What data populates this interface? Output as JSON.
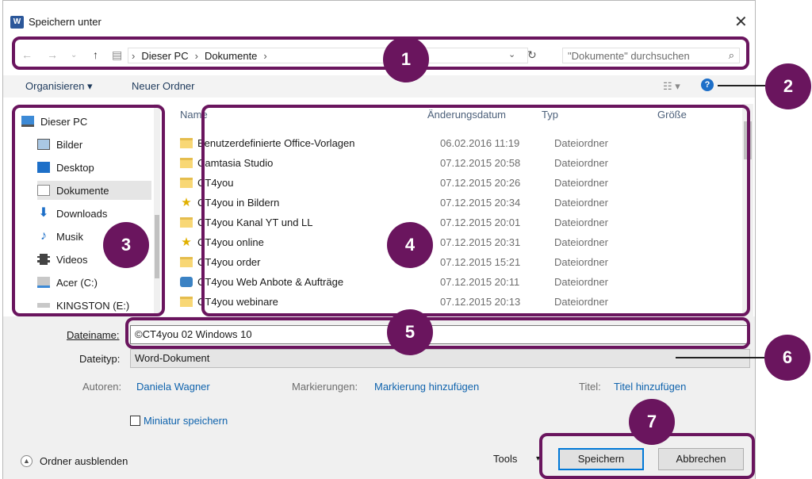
{
  "window": {
    "title": "Speichern unter",
    "close_icon": "close-icon",
    "app_icon": "word-icon"
  },
  "address": {
    "crumbs": [
      "Dieser PC",
      "Dokumente"
    ],
    "separator": "›",
    "search_placeholder": "\"Dokumente\" durchsuchen"
  },
  "toolbar": {
    "organize": "Organisieren ▾",
    "new_folder": "Neuer Ordner",
    "view_icon": "view-options-icon",
    "help_icon": "help-icon"
  },
  "sidebar": {
    "items": [
      {
        "label": "Dieser PC",
        "icon": "computer-icon"
      },
      {
        "label": "Bilder",
        "icon": "pictures-icon"
      },
      {
        "label": "Desktop",
        "icon": "desktop-icon"
      },
      {
        "label": "Dokumente",
        "icon": "documents-icon"
      },
      {
        "label": "Downloads",
        "icon": "downloads-icon"
      },
      {
        "label": "Musik",
        "icon": "music-icon"
      },
      {
        "label": "Videos",
        "icon": "videos-icon"
      },
      {
        "label": "Acer (C:)",
        "icon": "drive-icon"
      },
      {
        "label": "KINGSTON (E:)",
        "icon": "usb-drive-icon"
      }
    ],
    "selected": "Dokumente"
  },
  "filelist": {
    "columns": [
      "Name",
      "Änderungsdatum",
      "Typ",
      "Größe"
    ],
    "rows": [
      {
        "name": "Benutzerdefinierte Office-Vorlagen",
        "date": "06.02.2016 11:19",
        "type": "Dateiordner",
        "icon": "folder-icon"
      },
      {
        "name": "Camtasia Studio",
        "date": "07.12.2015 20:58",
        "type": "Dateiordner",
        "icon": "folder-icon"
      },
      {
        "name": "CT4you",
        "date": "07.12.2015 20:26",
        "type": "Dateiordner",
        "icon": "folder-icon"
      },
      {
        "name": "CT4you in Bildern",
        "date": "07.12.2015 20:34",
        "type": "Dateiordner",
        "icon": "favorite-folder-icon"
      },
      {
        "name": "CT4you Kanal YT und LL",
        "date": "07.12.2015 20:01",
        "type": "Dateiordner",
        "icon": "folder-icon"
      },
      {
        "name": "CT4you online",
        "date": "07.12.2015 20:31",
        "type": "Dateiordner",
        "icon": "favorite-folder-icon"
      },
      {
        "name": "CT4you order",
        "date": "07.12.2015 15:21",
        "type": "Dateiordner",
        "icon": "folder-icon"
      },
      {
        "name": "CT4you Web Anbote & Aufträge",
        "date": "07.12.2015 20:11",
        "type": "Dateiordner",
        "icon": "shortcut-folder-icon"
      },
      {
        "name": "CT4you webinare",
        "date": "07.12.2015 20:13",
        "type": "Dateiordner",
        "icon": "folder-icon"
      }
    ]
  },
  "form": {
    "filename_label": "Dateiname:",
    "filename_value": "©CT4you 02 Windows 10",
    "filetype_label": "Dateityp:",
    "filetype_value": "Word-Dokument",
    "authors_label": "Autoren:",
    "authors_value": "Daniela Wagner",
    "tags_label": "Markierungen:",
    "tags_value": "Markierung hinzufügen",
    "title_label": "Titel:",
    "title_value": "Titel hinzufügen",
    "thumbnail_label": "Miniatur speichern"
  },
  "footer": {
    "hide_folders": "Ordner ausblenden",
    "tools": "Tools",
    "save": "Speichern",
    "cancel": "Abbrechen"
  },
  "annotations": {
    "labels": [
      "1",
      "2",
      "3",
      "4",
      "5",
      "6",
      "7"
    ],
    "color": "#6a155e"
  }
}
